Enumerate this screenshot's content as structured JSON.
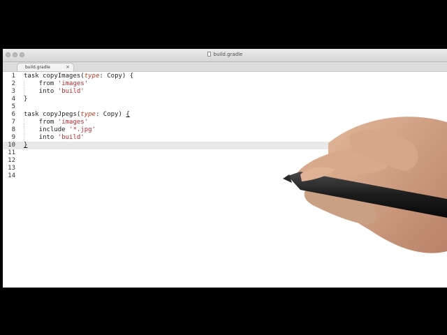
{
  "window": {
    "title": "build.gradle",
    "tab_label": "build.gradle",
    "tab_close": "×"
  },
  "editor": {
    "lines": [
      {
        "n": "1",
        "parts": [
          [
            "task copyImages(",
            ""
          ],
          [
            "type",
            "kw"
          ],
          [
            ": Copy) {",
            ""
          ]
        ]
      },
      {
        "n": "2",
        "parts": [
          [
            "    from ",
            ""
          ],
          [
            "'images'",
            "str"
          ]
        ]
      },
      {
        "n": "3",
        "parts": [
          [
            "    into ",
            ""
          ],
          [
            "'build'",
            "str"
          ]
        ]
      },
      {
        "n": "4",
        "parts": [
          [
            "}",
            ""
          ]
        ]
      },
      {
        "n": "5",
        "parts": []
      },
      {
        "n": "6",
        "parts": [
          [
            "task copyJpegs(",
            ""
          ],
          [
            "type",
            "kw"
          ],
          [
            ": Copy) ",
            ""
          ],
          [
            "{",
            "brace"
          ]
        ]
      },
      {
        "n": "7",
        "parts": [
          [
            "    from ",
            ""
          ],
          [
            "'images'",
            "str"
          ]
        ]
      },
      {
        "n": "8",
        "parts": [
          [
            "    include ",
            ""
          ],
          [
            "'*.jpg'",
            "str"
          ]
        ]
      },
      {
        "n": "9",
        "parts": [
          [
            "    into ",
            ""
          ],
          [
            "'build'",
            "str"
          ]
        ]
      },
      {
        "n": "10",
        "parts": [
          [
            "}",
            "brace"
          ]
        ]
      },
      {
        "n": "11",
        "parts": []
      },
      {
        "n": "12",
        "parts": []
      },
      {
        "n": "13",
        "parts": []
      },
      {
        "n": "14",
        "parts": []
      }
    ],
    "active_line": "10"
  },
  "colors": {
    "keyword_type": "#c83a1f",
    "string": "#c0282d",
    "active_line_bg": "#e8e8e8"
  }
}
